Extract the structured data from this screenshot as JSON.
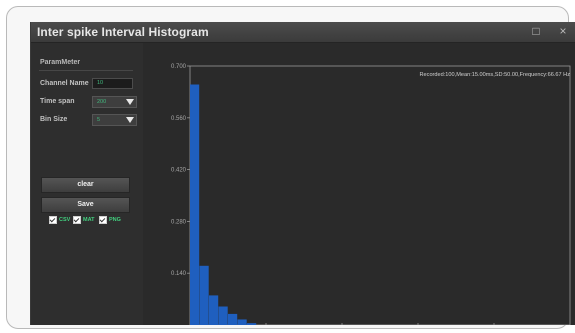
{
  "window": {
    "title": "Inter spike Interval Histogram",
    "maximize_icon": "maximize-icon",
    "close_icon": "close-icon",
    "close_glyph": "×",
    "maximize_glyph": "□"
  },
  "panel": {
    "section_title": "ParamMeter",
    "channel_name_label": "Channel Name",
    "channel_name_value": "10",
    "time_span_label": "Time span",
    "time_span_value": "200",
    "bin_size_label": "Bin Size",
    "bin_size_value": "5",
    "clear_label": "clear",
    "save_label": "Save",
    "checkboxes": [
      {
        "label": "CSV",
        "checked": true
      },
      {
        "label": "MAT",
        "checked": true
      },
      {
        "label": "PNG",
        "checked": true
      }
    ]
  },
  "colors": {
    "bar": "#1f5fbf",
    "axis": "#9a9a9a",
    "tick_text": "#a8a8a8",
    "info_text": "#d0d0d0"
  },
  "chart_data": {
    "type": "bar",
    "annotation": "Recorded:100,Mean:15.00ms,SD:50.00,Frequency:66.67 Hz",
    "ylim": [
      0,
      0.7
    ],
    "yticks": [
      0.14,
      0.28,
      0.42,
      0.56,
      0.7
    ],
    "ytick_labels": [
      "0.140",
      "0.280",
      "0.420",
      "0.560",
      "0.700"
    ],
    "xlim": [
      0,
      200
    ],
    "bin_width": 5,
    "values": [
      0.65,
      0.16,
      0.08,
      0.05,
      0.03,
      0.015,
      0.005
    ]
  }
}
